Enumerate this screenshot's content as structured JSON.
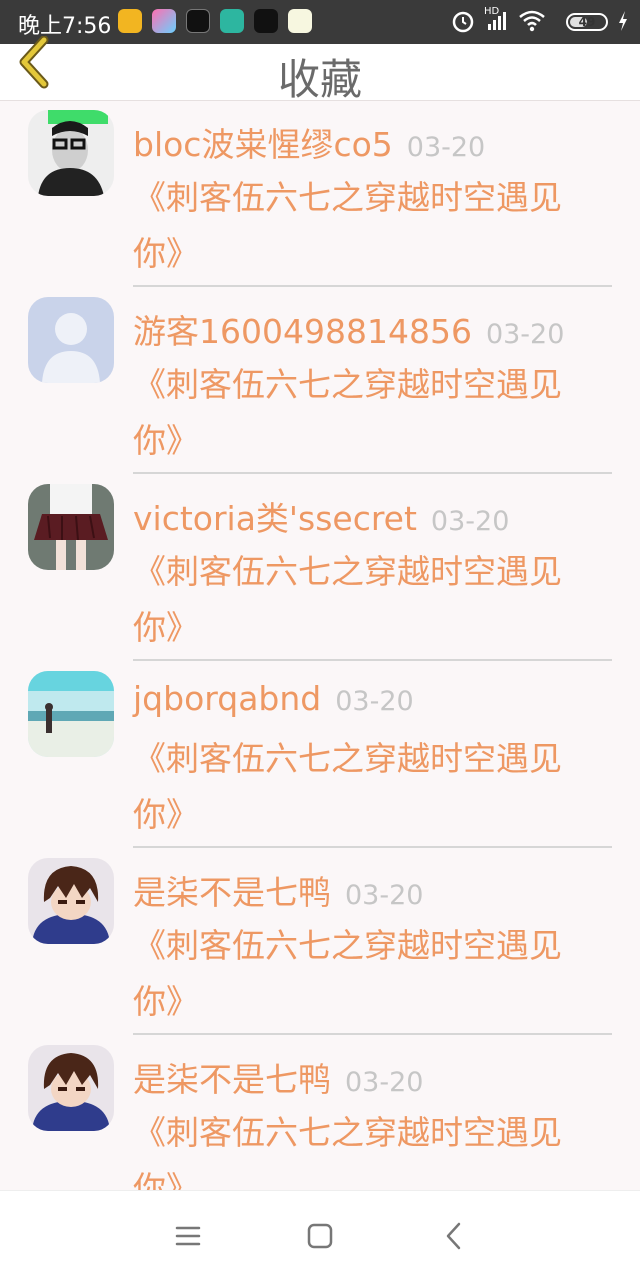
{
  "status_bar": {
    "time": "晚上7:56",
    "network": "HD",
    "battery": "49",
    "battery_fraction": 0.49
  },
  "header": {
    "title": "收藏",
    "back_icon": "chevron-left-icon"
  },
  "favorites": [
    {
      "user": "bloc波粜惺缪co5",
      "date": "03-20",
      "content": "《刺客伍六七之穿越时空遇见你》"
    },
    {
      "user": "游客1600498814856",
      "date": "03-20",
      "content": "《刺客伍六七之穿越时空遇见你》"
    },
    {
      "user": "victoria类'ssecret",
      "date": "03-20",
      "content": "《刺客伍六七之穿越时空遇见你》"
    },
    {
      "user": "jqborqabnd",
      "date": "03-20",
      "content": "《刺客伍六七之穿越时空遇见你》"
    },
    {
      "user": "是柒不是七鸭",
      "date": "03-20",
      "content": "《刺客伍六七之穿越时空遇见你》"
    },
    {
      "user": "是柒不是七鸭",
      "date": "03-20",
      "content": "《刺客伍六七之穿越时空遇见你》"
    }
  ],
  "nav_bar": {
    "menu_icon": "menu-icon",
    "home_icon": "home-square-icon",
    "back_icon": "back-triangle-icon"
  },
  "colors": {
    "accent": "#ee9863",
    "date": "#c6c6c6",
    "title": "#6a6a6a",
    "back_arrow": "#e3c83a"
  }
}
